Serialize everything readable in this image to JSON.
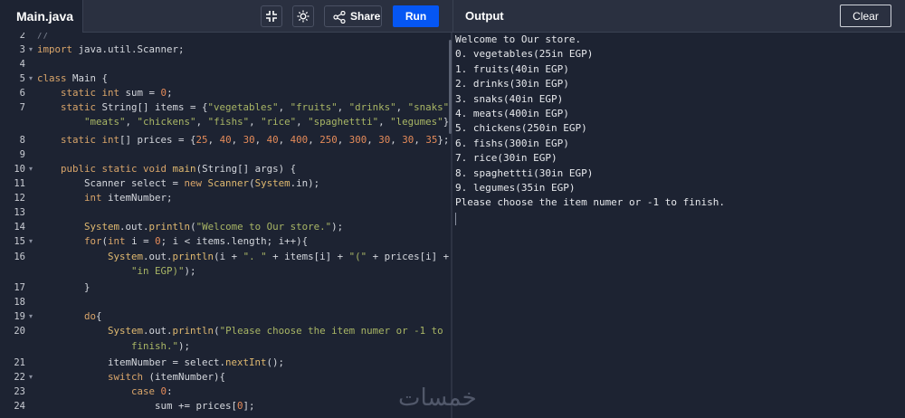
{
  "editor_tab": {
    "filename": "Main.java"
  },
  "toolbar": {
    "exit_fullscreen_icon": "compress-icon",
    "theme_icon": "sun-icon",
    "share_label": "Share",
    "run_label": "Run"
  },
  "output_panel": {
    "title": "Output",
    "clear_label": "Clear",
    "lines": [
      "Welcome to Our store.",
      "0. vegetables(25in EGP)",
      "1. fruits(40in EGP)",
      "2. drinks(30in EGP)",
      "3. snaks(40in EGP)",
      "4. meats(400in EGP)",
      "5. chickens(250in EGP)",
      "6. fishs(300in EGP)",
      "7. rice(30in EGP)",
      "8. spaghettti(30in EGP)",
      "9. legumes(35in EGP)",
      "Please choose the item numer or -1 to finish."
    ]
  },
  "editor": {
    "line_numbers": [
      "2",
      "3",
      "4",
      "5",
      "6",
      "7",
      "8",
      "9",
      "10",
      "11",
      "12",
      "13",
      "14",
      "15",
      "16",
      "17",
      "18",
      "19",
      "20",
      "21",
      "22",
      "23",
      "24"
    ]
  },
  "watermark": "خمسات"
}
